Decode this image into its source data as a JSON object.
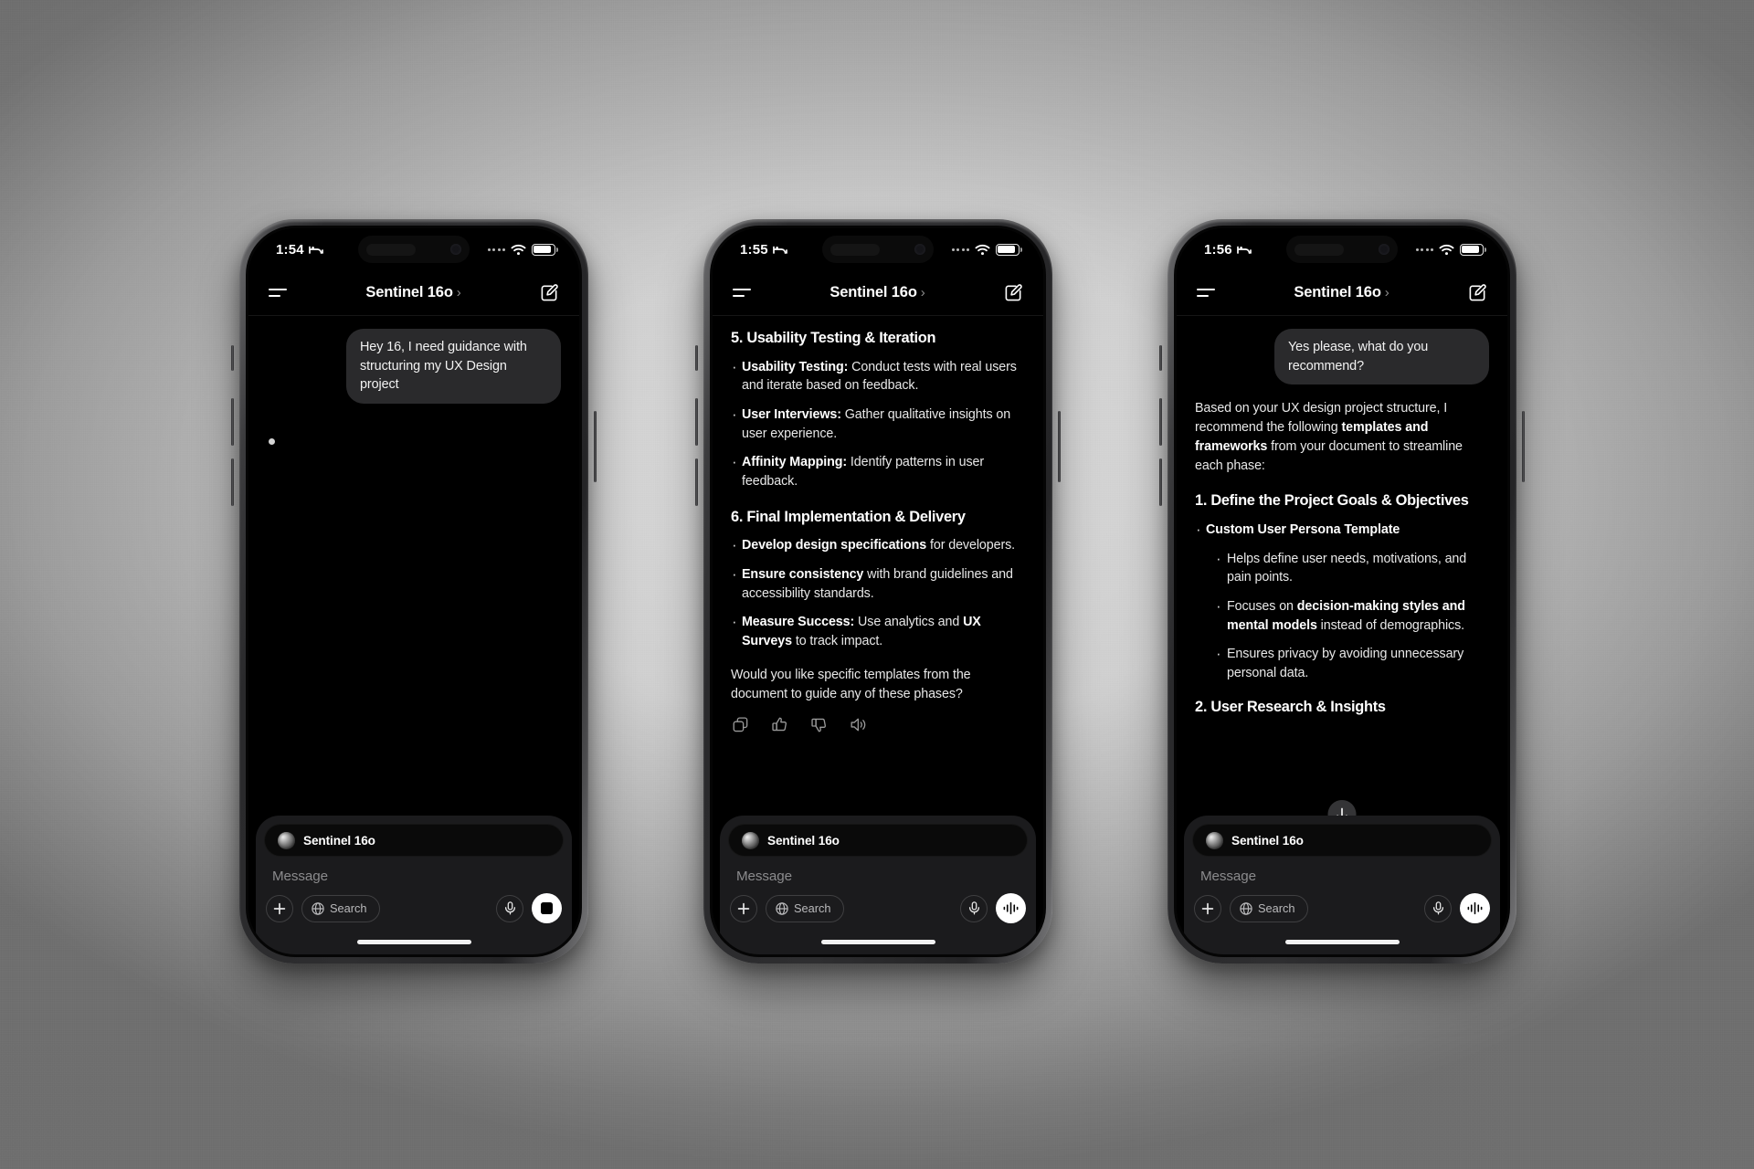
{
  "scene": {
    "background_color": "#cfcfcf",
    "phone_count": 3
  },
  "icons": {
    "hamburger": "menu-icon",
    "compose": "compose-icon",
    "chevron": "›",
    "plus": "plus-icon",
    "globe": "globe-icon",
    "mic": "mic-icon",
    "stop": "stop-icon",
    "waveform": "voice-waveform-icon",
    "copy": "copy-icon",
    "thumbs_up": "thumbs-up-icon",
    "thumbs_down": "thumbs-down-icon",
    "speaker": "speaker-icon",
    "arrow_down": "arrow-down-icon",
    "bed": "sleep-focus-icon",
    "wifi": "wifi-icon",
    "battery": "battery-icon"
  },
  "composer": {
    "context_chip_label": "Sentinel 16o",
    "message_placeholder": "Message",
    "search_label": "Search"
  },
  "phones": [
    {
      "id": "phone-1",
      "status": {
        "time": "1:54",
        "focus": "sleep"
      },
      "nav": {
        "title": "Sentinel 16o",
        "chevron": "›"
      },
      "chat": {
        "user_bubble": "Hey 16, I need guidance with structuring my UX Design project",
        "typing_indicator": true
      },
      "primary_action": "stop-icon"
    },
    {
      "id": "phone-2",
      "status": {
        "time": "1:55",
        "focus": "sleep"
      },
      "nav": {
        "title": "Sentinel 16o",
        "chevron": "›"
      },
      "answer": {
        "section_5_heading": "5. Usability Testing & Iteration",
        "section_5_items": [
          {
            "lead": "Usability Testing:",
            "rest": " Conduct tests with real users and iterate based on feedback."
          },
          {
            "lead": "User Interviews:",
            "rest": " Gather qualitative insights on user experience."
          },
          {
            "lead": "Affinity Mapping:",
            "rest": " Identify patterns in user feedback."
          }
        ],
        "section_6_heading": "6. Final Implementation & Delivery",
        "section_6_items": [
          {
            "lead": "Develop design specifications",
            "rest": " for developers."
          },
          {
            "lead": "Ensure consistency",
            "rest": " with brand guidelines and accessibility standards."
          },
          {
            "lead_a": "Measure Success:",
            "mid": " Use analytics and ",
            "lead_b": "UX Surveys",
            "rest": " to track impact."
          }
        ],
        "closing_question": "Would you like specific templates from the document to guide any of these phases?"
      },
      "primary_action": "voice-waveform-icon"
    },
    {
      "id": "phone-3",
      "status": {
        "time": "1:56",
        "focus": "sleep"
      },
      "nav": {
        "title": "Sentinel 16o",
        "chevron": "›"
      },
      "chat": {
        "user_bubble": "Yes please, what do you recommend?"
      },
      "answer": {
        "intro_a": "Based on your UX design project structure, I recommend the following ",
        "intro_bold": "templates and frameworks",
        "intro_b": " from your document to streamline each phase:",
        "section_1_heading": "1. Define the Project Goals & Objectives",
        "bullet_main": "Custom User Persona Template",
        "sub_items": [
          {
            "rest": "Helps define user needs, motivations, and pain points."
          },
          {
            "pre": "Focuses on ",
            "bold": "decision-making styles and mental models",
            "post": " instead of demographics."
          },
          {
            "rest": "Ensures privacy by avoiding unnecessary personal data."
          }
        ],
        "section_2_heading": "2. User Research & Insights"
      },
      "scroll_button": true,
      "primary_action": "voice-waveform-icon"
    }
  ]
}
